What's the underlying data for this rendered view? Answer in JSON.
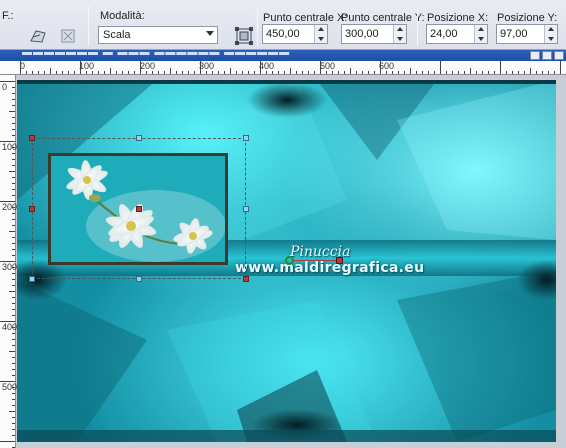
{
  "toolbar": {
    "preset_label": "F.:",
    "mode_label": "Modalità:",
    "mode_value": "Scala",
    "pivot_x_label": "Punto centrale X:",
    "pivot_x_value": "450,00",
    "pivot_y_label": "Punto centrale Y:",
    "pivot_y_value": "300,00",
    "pos_x_label": "Posizione X:",
    "pos_x_value": "24,00",
    "pos_y_label": "Posizione Y:",
    "pos_y_value": "97,00"
  },
  "ruler": {
    "top_labels": [
      "0",
      "100",
      "200",
      "300",
      "400",
      "500",
      "600"
    ],
    "left_labels": [
      "0",
      "100",
      "200",
      "300",
      "400",
      "500"
    ]
  },
  "canvas": {
    "watermark_name": "Pinuccia",
    "watermark_url": "www.maldiregrafica.eu"
  },
  "icons": [
    "deform-icon",
    "reset-icon",
    "pivot-icon"
  ],
  "colors": {
    "toolbar_bg": "#e2e6ee",
    "title_bar": "#2358b0",
    "canvas_teal": "#1aa0b4",
    "canvas_bright": "#3ee6f2",
    "handle_red": "#b53b3b"
  }
}
